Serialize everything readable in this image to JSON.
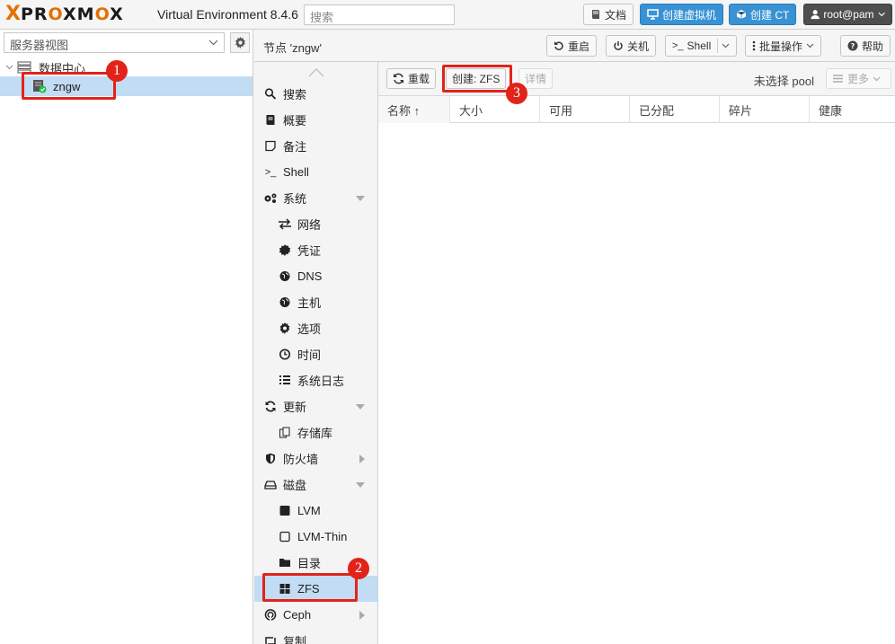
{
  "header": {
    "logo_x": "X",
    "logo_text": [
      "PR",
      "O",
      "XM",
      "O",
      "X"
    ],
    "ve_title": "Virtual Environment 8.4.6",
    "search_placeholder": "搜索",
    "docs_label": "文档",
    "create_vm_label": "创建虚拟机",
    "create_ct_label": "创建 CT",
    "user_label": "root@pam"
  },
  "tree": {
    "view_label": "服务器视图",
    "datacenter_label": "数据中心",
    "node_label": "zngw"
  },
  "content_header": {
    "node_title": "节点 'zngw'",
    "reboot_label": "重启",
    "shutdown_label": "关机",
    "shell_label": "Shell",
    "bulk_label": "批量操作",
    "help_label": "帮助"
  },
  "menu": {
    "items": [
      {
        "label": "搜索",
        "icon": "search-icon"
      },
      {
        "label": "概要",
        "icon": "book-icon"
      },
      {
        "label": "备注",
        "icon": "note-icon"
      },
      {
        "label": "Shell",
        "icon": "terminal-icon"
      },
      {
        "label": "系统",
        "icon": "cogs-icon"
      },
      {
        "label": "网络",
        "icon": "exchange-icon"
      },
      {
        "label": "凭证",
        "icon": "certificate-icon"
      },
      {
        "label": "DNS",
        "icon": "globe-icon"
      },
      {
        "label": "主机",
        "icon": "globe-icon"
      },
      {
        "label": "选项",
        "icon": "gear-icon"
      },
      {
        "label": "时间",
        "icon": "clock-icon"
      },
      {
        "label": "系统日志",
        "icon": "list-icon"
      },
      {
        "label": "更新",
        "icon": "refresh-icon"
      },
      {
        "label": "存储库",
        "icon": "files-icon"
      },
      {
        "label": "防火墙",
        "icon": "shield-icon"
      },
      {
        "label": "磁盘",
        "icon": "hdd-icon"
      },
      {
        "label": "LVM",
        "icon": "square-icon"
      },
      {
        "label": "LVM-Thin",
        "icon": "square-outline-icon"
      },
      {
        "label": "目录",
        "icon": "folder-icon"
      },
      {
        "label": "ZFS",
        "icon": "th-large-icon"
      },
      {
        "label": "Ceph",
        "icon": "ceph-icon"
      },
      {
        "label": "复制",
        "icon": "retweet-icon"
      }
    ]
  },
  "toolbar": {
    "reload_label": "重载",
    "create_zfs_label": "创建: ZFS",
    "detail_label": "详情",
    "pool_status": "未选择 pool",
    "more_label": "更多"
  },
  "grid": {
    "columns": [
      "名称 ↑",
      "大小",
      "可用",
      "已分配",
      "碎片",
      "健康"
    ]
  },
  "annotations": [
    "1",
    "2",
    "3"
  ],
  "colors": {
    "accent_orange": "#e57000",
    "button_blue": "#3892d4",
    "selection_blue": "#c2dcf3",
    "annotation_red": "#e2231a"
  }
}
